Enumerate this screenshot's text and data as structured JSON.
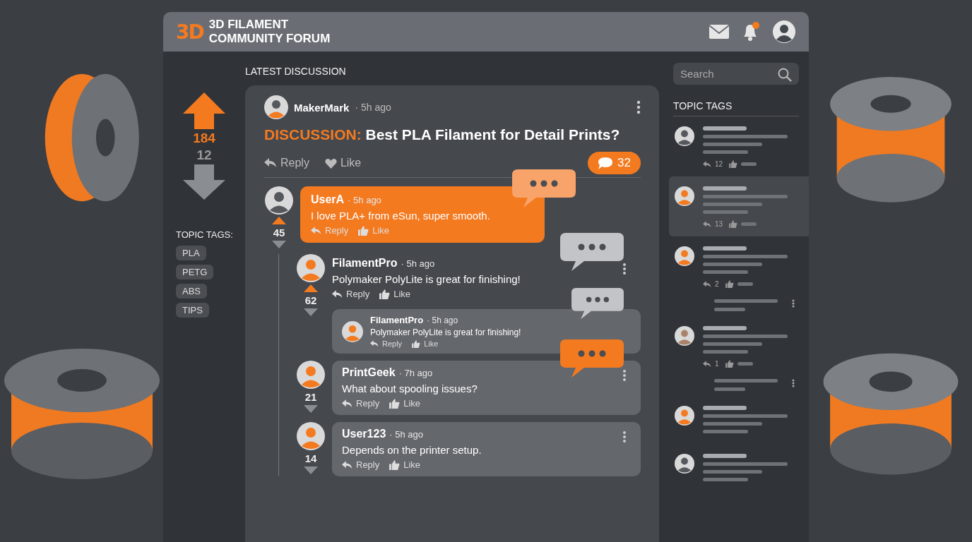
{
  "header": {
    "logo": "3D",
    "title_lines": [
      "3D FILAMENT",
      "COMMUNITY FORUM"
    ],
    "has_notification": true
  },
  "section_title": "LATEST DISCUSSION",
  "votes": {
    "up": "184",
    "down": "12"
  },
  "tags_title": "TOPIC TAGS:",
  "tags": [
    "PLA",
    "PETG",
    "ABS",
    "TIPS"
  ],
  "post": {
    "author": "MakerMark",
    "time": "· 5h ago",
    "title": "**DISCUSSION:** Best PLA Filament for Detail Prints?",
    "reply": "Reply",
    "like": "Like",
    "comment_count": "32",
    "comments": [
      {
        "kind": "highlight",
        "author": "UserA",
        "time": "· 5h ago",
        "text": "I love PLA+ from eSun, super smooth.",
        "votes": "45",
        "reply": "Reply",
        "like": "Like",
        "avatar": {
          "color": "#55585d"
        },
        "typing_bubble": {
          "color": "#f7a36a"
        },
        "children": [
          {
            "kind": "plain",
            "author": "FilamentPro",
            "time": "· 5h ago",
            "text": "Polymaker PolyLite is great for finishing!",
            "votes": "62",
            "reply": "Reply",
            "like": "Like",
            "avatar": {
              "color": "#f47a20"
            },
            "typing_bubble": {
              "color": "#c2c4c7"
            },
            "children": [
              {
                "kind": "small",
                "author": "FilamentPro",
                "time": "· 5h ago",
                "text": "Polymaker PolyLite is great for finishing!",
                "reply": "Reply",
                "like": "Like",
                "avatar": {
                  "color": "#f47a20"
                },
                "typing_bubble": {
                  "color": "#c2c4c7"
                }
              }
            ]
          },
          {
            "kind": "card",
            "author": "PrintGeek",
            "time": "· 7h ago",
            "text": "What about spooling issues?",
            "votes": "21",
            "reply": "Reply",
            "like": "Like",
            "avatar": {
              "color": "#f47a20"
            },
            "typing_bubble": {
              "color": "#f47a20"
            }
          },
          {
            "kind": "card",
            "author": "User123",
            "time": "· 5h ago",
            "text": "Depends on the printer setup.",
            "votes": "14",
            "reply": "Reply",
            "like": "Like",
            "avatar": {
              "color": "#f47a20"
            }
          }
        ]
      }
    ]
  },
  "search": {
    "placeholder": "Search"
  },
  "sidebar": {
    "title": "TOPIC TAGS",
    "items": [
      {
        "kind": "post",
        "selected": false,
        "count": "12",
        "avatar": {
          "color": "#55585d"
        }
      },
      {
        "kind": "post",
        "selected": true,
        "count": "13",
        "avatar": {
          "color": "#f47a20"
        }
      },
      {
        "kind": "post",
        "selected": false,
        "count": "2",
        "avatar": {
          "color": "#f47a20"
        }
      },
      {
        "kind": "reply"
      },
      {
        "kind": "post",
        "selected": false,
        "count": "1",
        "avatar": {
          "color": "#a9826a"
        }
      },
      {
        "kind": "reply"
      },
      {
        "kind": "post",
        "selected": false,
        "avatar": {
          "color": "#f47a20"
        }
      },
      {
        "kind": "post",
        "selected": false,
        "avatar": {
          "color": "#55585d"
        }
      }
    ]
  }
}
